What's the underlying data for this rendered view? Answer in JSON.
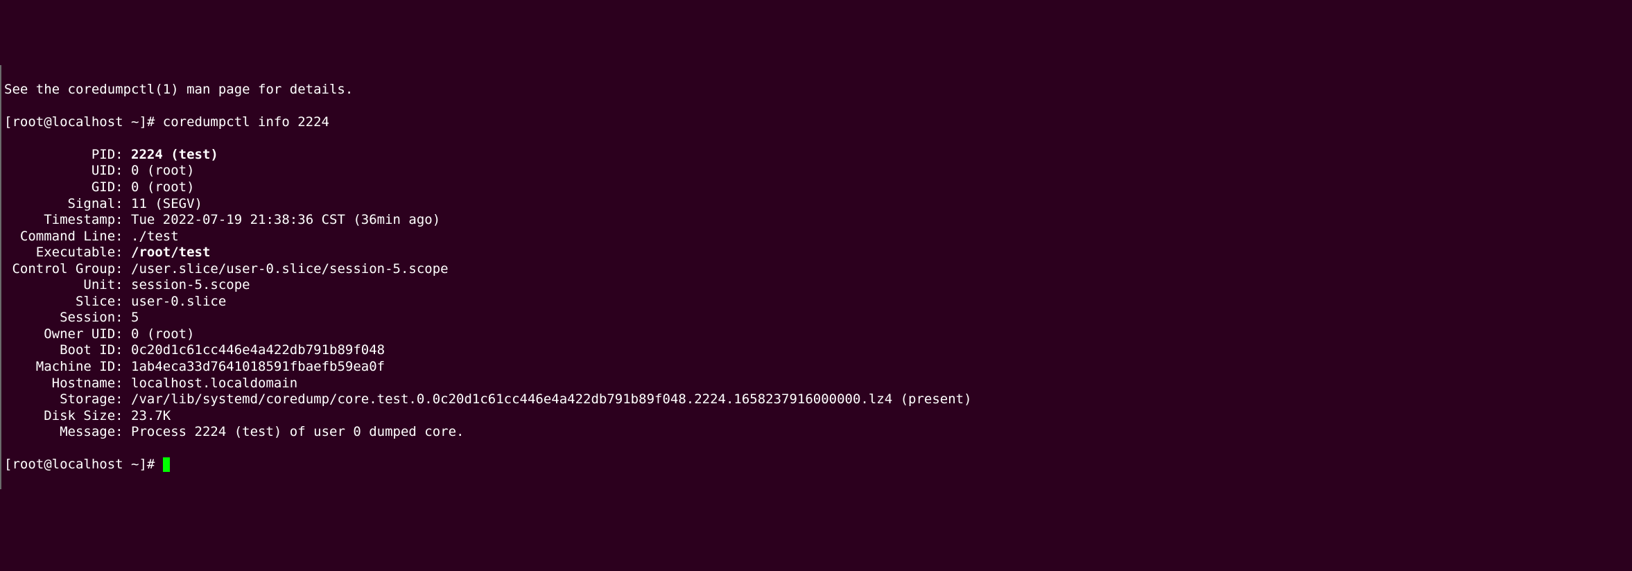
{
  "partial_top": "See the coredumpctl(1) man page for details.",
  "prompt1": "[root@localhost ~]# ",
  "command": "coredumpctl info 2224",
  "fields": [
    {
      "label": "           PID: ",
      "value": "2224 (test)",
      "bold": true
    },
    {
      "label": "           UID: ",
      "value": "0 (root)",
      "bold": false
    },
    {
      "label": "           GID: ",
      "value": "0 (root)",
      "bold": false
    },
    {
      "label": "        Signal: ",
      "value": "11 (SEGV)",
      "bold": false
    },
    {
      "label": "     Timestamp: ",
      "value": "Tue 2022-07-19 21:38:36 CST (36min ago)",
      "bold": false
    },
    {
      "label": "  Command Line: ",
      "value": "./test",
      "bold": false
    },
    {
      "label": "    Executable: ",
      "value": "/root/test",
      "bold": true
    },
    {
      "label": " Control Group: ",
      "value": "/user.slice/user-0.slice/session-5.scope",
      "bold": false
    },
    {
      "label": "          Unit: ",
      "value": "session-5.scope",
      "bold": false
    },
    {
      "label": "         Slice: ",
      "value": "user-0.slice",
      "bold": false
    },
    {
      "label": "       Session: ",
      "value": "5",
      "bold": false
    },
    {
      "label": "     Owner UID: ",
      "value": "0 (root)",
      "bold": false
    },
    {
      "label": "       Boot ID: ",
      "value": "0c20d1c61cc446e4a422db791b89f048",
      "bold": false
    },
    {
      "label": "    Machine ID: ",
      "value": "1ab4eca33d7641018591fbaefb59ea0f",
      "bold": false
    },
    {
      "label": "      Hostname: ",
      "value": "localhost.localdomain",
      "bold": false
    },
    {
      "label": "       Storage: ",
      "value": "/var/lib/systemd/coredump/core.test.0.0c20d1c61cc446e4a422db791b89f048.2224.1658237916000000.lz4 (present)",
      "bold": false
    },
    {
      "label": "     Disk Size: ",
      "value": "23.7K",
      "bold": false
    },
    {
      "label": "       Message: ",
      "value": "Process 2224 (test) of user 0 dumped core.",
      "bold": false
    }
  ],
  "prompt2": "[root@localhost ~]# "
}
